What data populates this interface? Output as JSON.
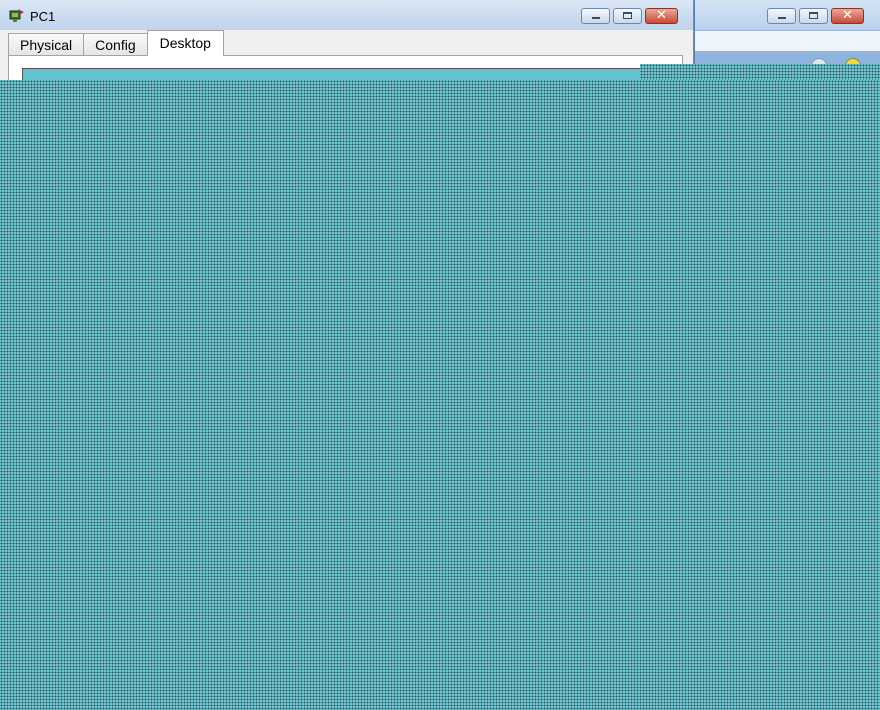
{
  "main_window": {
    "title": "PC1",
    "app_icon": "packet-tracer-pc-icon"
  },
  "tabs": [
    {
      "label": "Physical",
      "active": false
    },
    {
      "label": "Config",
      "active": false
    },
    {
      "label": "Desktop",
      "active": true
    }
  ],
  "window_controls": {
    "minimize_icon": "minimize-icon",
    "maximize_icon": "maximize-icon",
    "close_icon": "close-icon",
    "close_glyph": "✕"
  },
  "colors": {
    "desktop_teal": "#6cc4cf",
    "close_red": "#c84a33",
    "titlebar_blue": "#bfd3ec"
  }
}
